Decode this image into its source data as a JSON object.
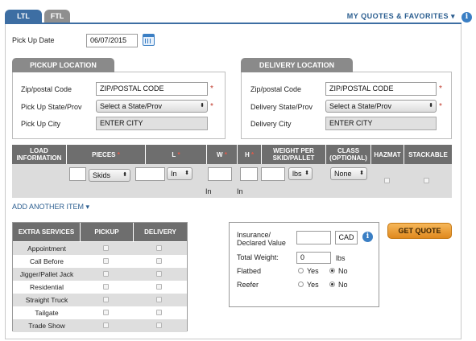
{
  "tabs": [
    {
      "label": "LTL"
    },
    {
      "label": "FTL"
    }
  ],
  "quotes_link": "MY QUOTES & FAVORITES",
  "pickup_date": {
    "label": "Pick Up Date",
    "value": "06/07/2015"
  },
  "pickup": {
    "title": "PICKUP LOCATION",
    "zip_label": "Zip/postal Code",
    "zip_value": "ZIP/POSTAL CODE",
    "state_label": "Pick Up State/Prov",
    "state_value": "Select a State/Prov",
    "city_label": "Pick Up City",
    "city_value": "ENTER CITY"
  },
  "delivery": {
    "title": "DELIVERY LOCATION",
    "zip_label": "Zip/postal Code",
    "zip_value": "ZIP/POSTAL CODE",
    "state_label": "Delivery State/Prov",
    "state_value": "Select a State/Prov",
    "city_label": "Delivery City",
    "city_value": "ENTER CITY"
  },
  "freight": {
    "headers": {
      "load_info": "LOAD INFORMATION",
      "pieces": "PIECES",
      "l": "L",
      "w": "W",
      "h": "H",
      "weight": "WEIGHT PER SKID/PALLET",
      "class": "CLASS (OPTIONAL)",
      "hazmat": "HAZMAT",
      "stackable": "STACKABLE"
    },
    "pieces_unit": "Skids",
    "length_unit": "In",
    "weight_unit": "lbs",
    "class_value": "None",
    "w_unit_text": "In",
    "h_unit_text": "In"
  },
  "add_item": "ADD ANOTHER ITEM",
  "extra_services": {
    "headers": {
      "name": "EXTRA SERVICES",
      "pickup": "PICKUP",
      "delivery": "DELIVERY"
    },
    "rows": [
      "Appointment",
      "Call Before",
      "Jigger/Pallet Jack",
      "Residential",
      "Straight Truck",
      "Tailgate",
      "Trade Show"
    ]
  },
  "insurance": {
    "label": "Insurance/ Declared Value",
    "currency": "CAD",
    "total_weight_label": "Total Weight:",
    "total_weight_value": "0",
    "total_weight_unit": "lbs",
    "flatbed_label": "Flatbed",
    "reefer_label": "Reefer",
    "yes": "Yes",
    "no": "No"
  },
  "get_quote": "GET QUOTE",
  "colors": {
    "accent": "#3d6ea3",
    "button": "#e8a23c",
    "header_grey": "#6e6e6e"
  }
}
